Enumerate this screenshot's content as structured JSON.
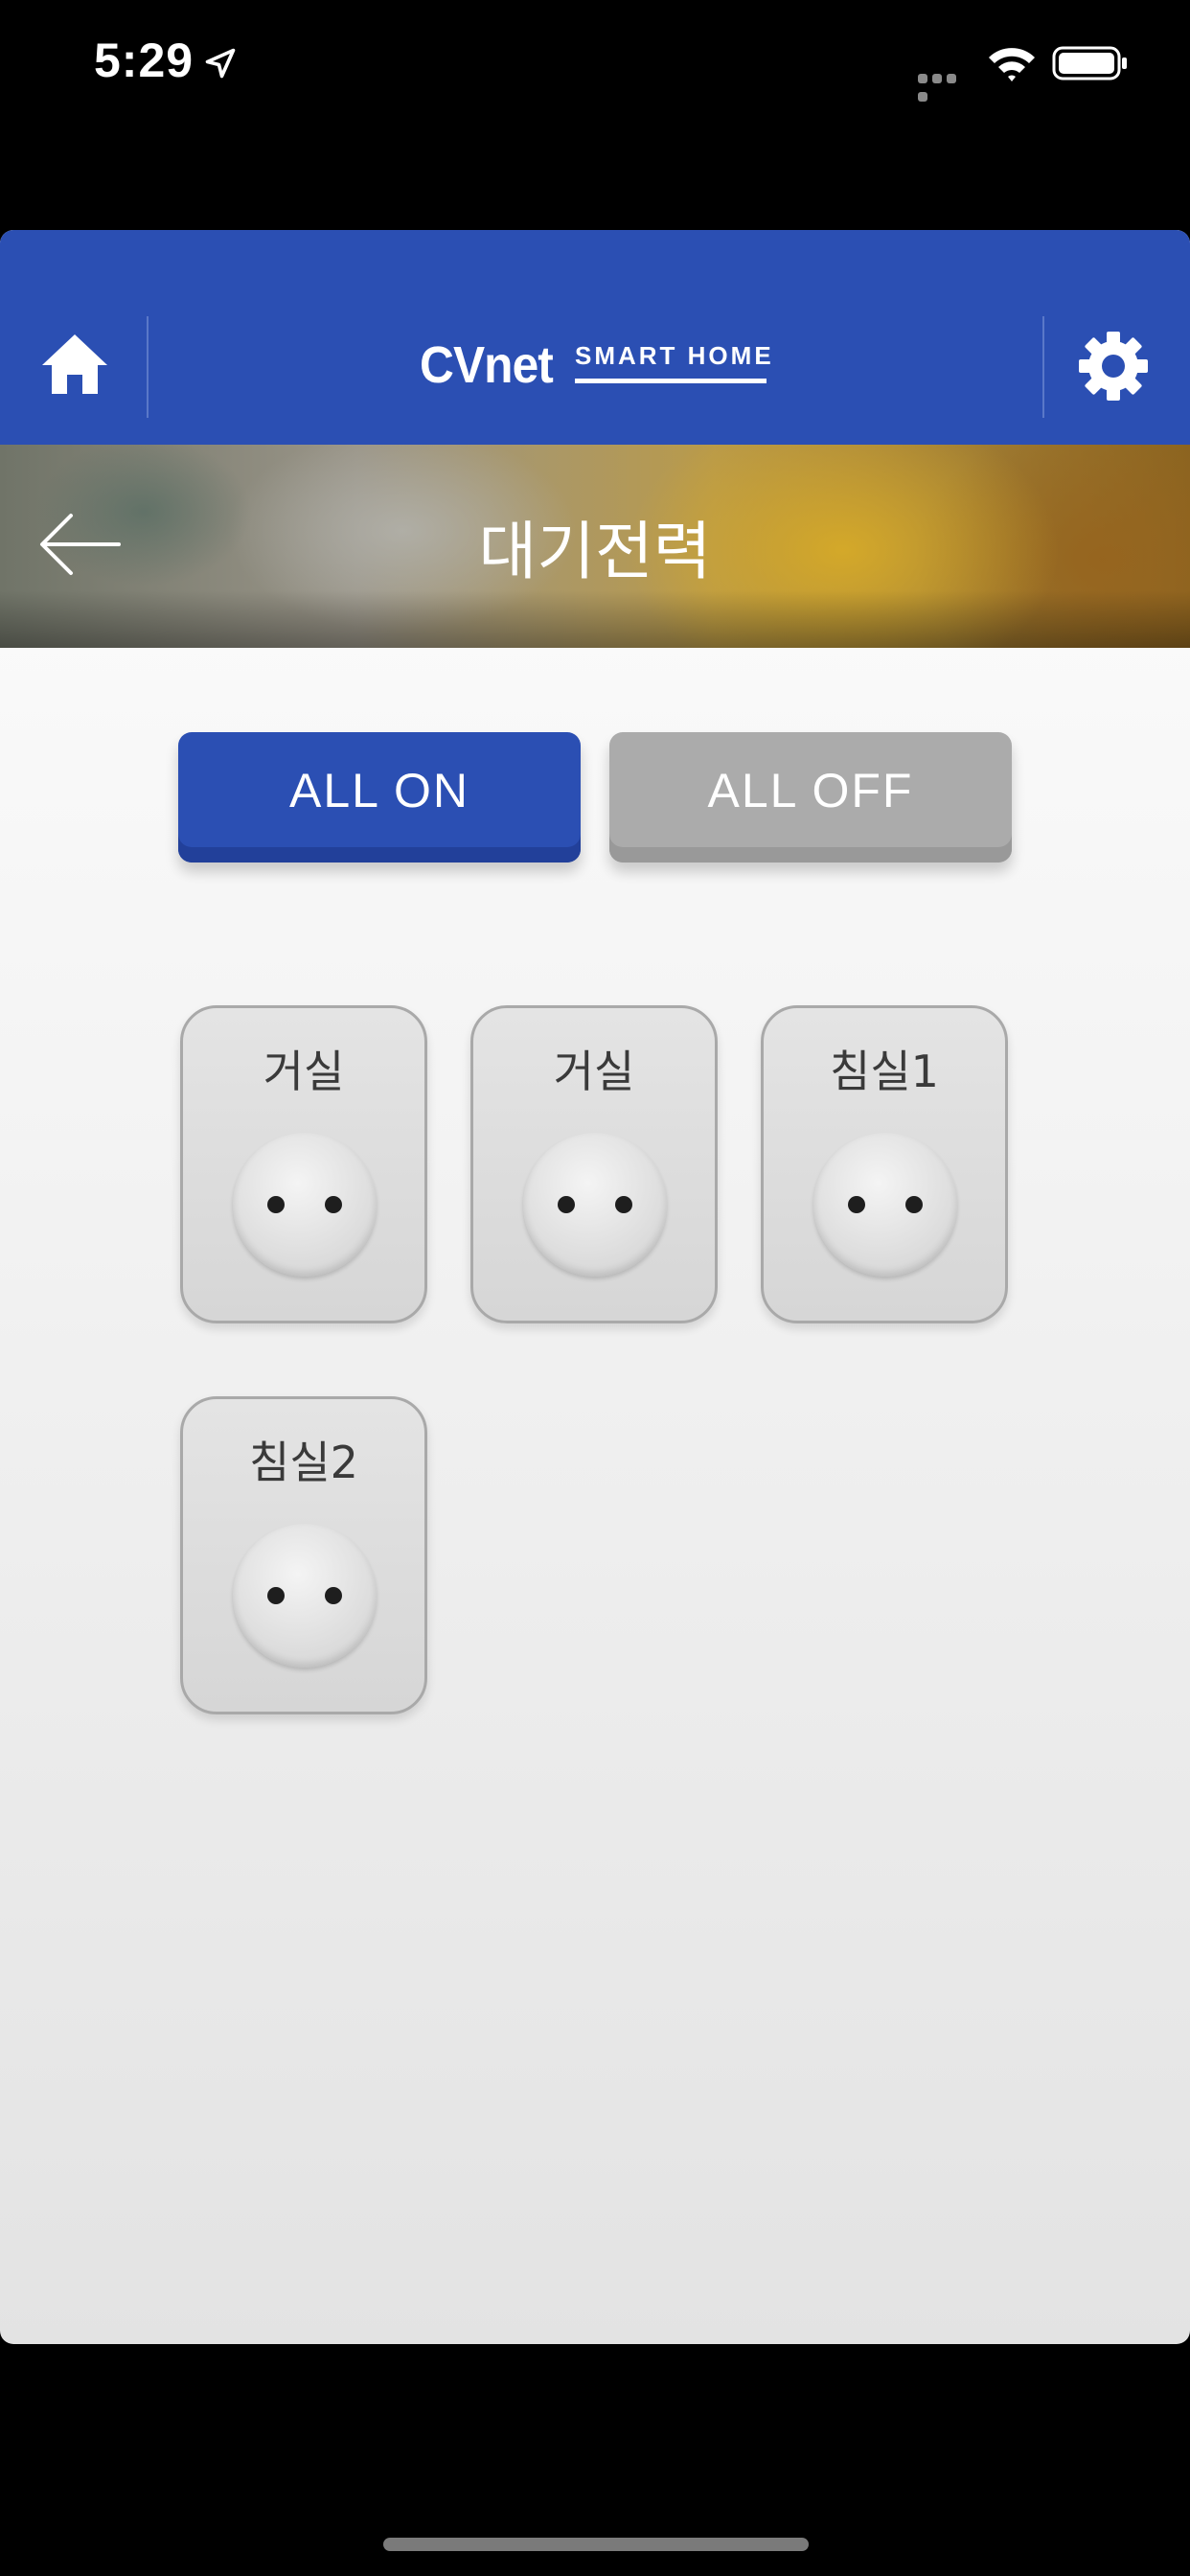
{
  "status_bar": {
    "time": "5:29"
  },
  "header": {
    "logo_main": "CVnet",
    "logo_sub": "SMART HOME"
  },
  "banner": {
    "title": "대기전력"
  },
  "controls": {
    "all_on_label": "ALL ON",
    "all_off_label": "ALL OFF"
  },
  "outlets": [
    {
      "label": "거실"
    },
    {
      "label": "거실"
    },
    {
      "label": "침실1"
    },
    {
      "label": "침실2"
    }
  ],
  "colors": {
    "brand_blue": "#2b4fb3",
    "off_gray": "#ababab"
  }
}
